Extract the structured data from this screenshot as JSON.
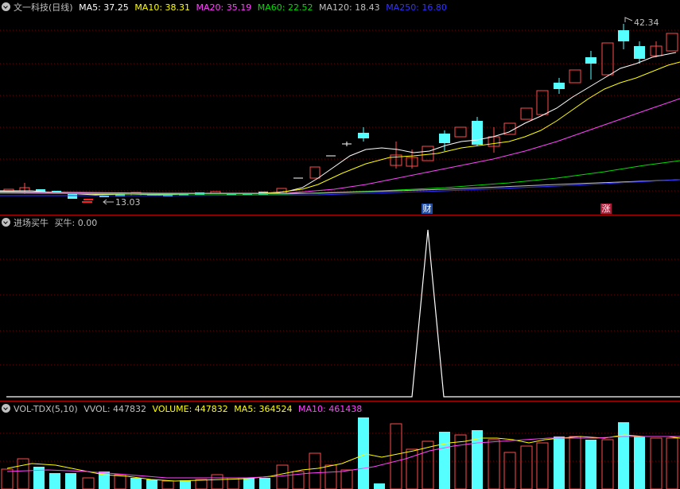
{
  "price_panel": {
    "title": "文一科技(日线)",
    "ma5_label": "MA5: 37.25",
    "ma10_label": "MA10: 38.31",
    "ma20_label": "MA20: 35.19",
    "ma60_label": "MA60: 22.52",
    "ma120_label": "MA120: 18.43",
    "ma250_label": "MA250: 16.80",
    "high_label": "42.34",
    "low_label": "13.03",
    "badge_cai": "财",
    "badge_zhang": "涨",
    "colors": {
      "ma5": "#ffffff",
      "ma10": "#ffff00",
      "ma20": "#ff44ff",
      "ma60": "#00dd00",
      "ma120": "#c0c0c0",
      "ma250": "#3333ff"
    }
  },
  "signal_panel": {
    "title": "进场买牛",
    "value_label": "买牛: 0.00"
  },
  "volume_panel": {
    "title": "VOL-TDX(5,10)",
    "vvol_label": "VVOL: 447832",
    "volume_label": "VOLUME: 447832",
    "ma5_label": "MA5: 364524",
    "ma10_label": "MA10: 461438"
  }
}
